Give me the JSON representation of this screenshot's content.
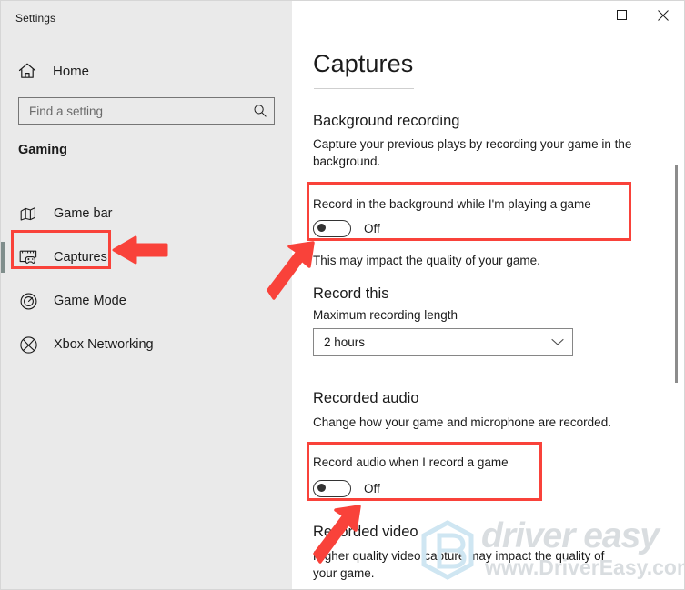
{
  "window": {
    "title": "Settings",
    "controls": [
      {
        "name": "minimize",
        "glyph": "minimize-icon"
      },
      {
        "name": "maximize",
        "glyph": "maximize-icon"
      },
      {
        "name": "close",
        "glyph": "close-icon"
      }
    ]
  },
  "sidebar": {
    "home_label": "Home",
    "home_icon": "home-icon",
    "search": {
      "placeholder": "Find a setting",
      "value": "",
      "icon": "search-icon"
    },
    "group_header": "Gaming",
    "items": [
      {
        "label": "Game bar",
        "icon": "game-bar-icon",
        "selected": false
      },
      {
        "label": "Captures",
        "icon": "captures-icon",
        "selected": true
      },
      {
        "label": "Game Mode",
        "icon": "game-mode-icon",
        "selected": false
      },
      {
        "label": "Xbox Networking",
        "icon": "xbox-icon",
        "selected": false
      }
    ]
  },
  "content": {
    "page_title": "Captures",
    "sections": [
      {
        "heading": "Background recording",
        "description": "Capture your previous plays by recording your game in the background.",
        "toggle_label": "Record in the background while I'm playing a game",
        "toggle_state": "Off",
        "footnote": "This may impact the quality of your game."
      },
      {
        "heading": "Record this",
        "sub_label": "Maximum recording length",
        "dropdown_value": "2 hours",
        "dropdown_icon": "chevron-down-icon"
      },
      {
        "heading": "Recorded audio",
        "description": "Change how your game and microphone are recorded.",
        "toggle_label": "Record audio when I record a game",
        "toggle_state": "Off"
      },
      {
        "heading": "Recorded video",
        "description": "Higher quality video capture may impact the quality of your game."
      }
    ]
  },
  "annotations": {
    "highlight_color": "#f9423a",
    "boxes": [
      {
        "name": "captures-nav-highlight"
      },
      {
        "name": "background-recording-toggle-highlight"
      },
      {
        "name": "record-audio-toggle-highlight"
      }
    ],
    "arrows": [
      {
        "name": "arrow-to-captures-nav",
        "direction": "left"
      },
      {
        "name": "arrow-to-background-toggle",
        "direction": "up-right"
      },
      {
        "name": "arrow-to-audio-toggle",
        "direction": "up-right"
      }
    ]
  },
  "watermark": {
    "brand": "driver easy",
    "url": "www.DriverEasy.com",
    "logo": "drivereasy-logo-icon",
    "color": "#d9dde0"
  }
}
